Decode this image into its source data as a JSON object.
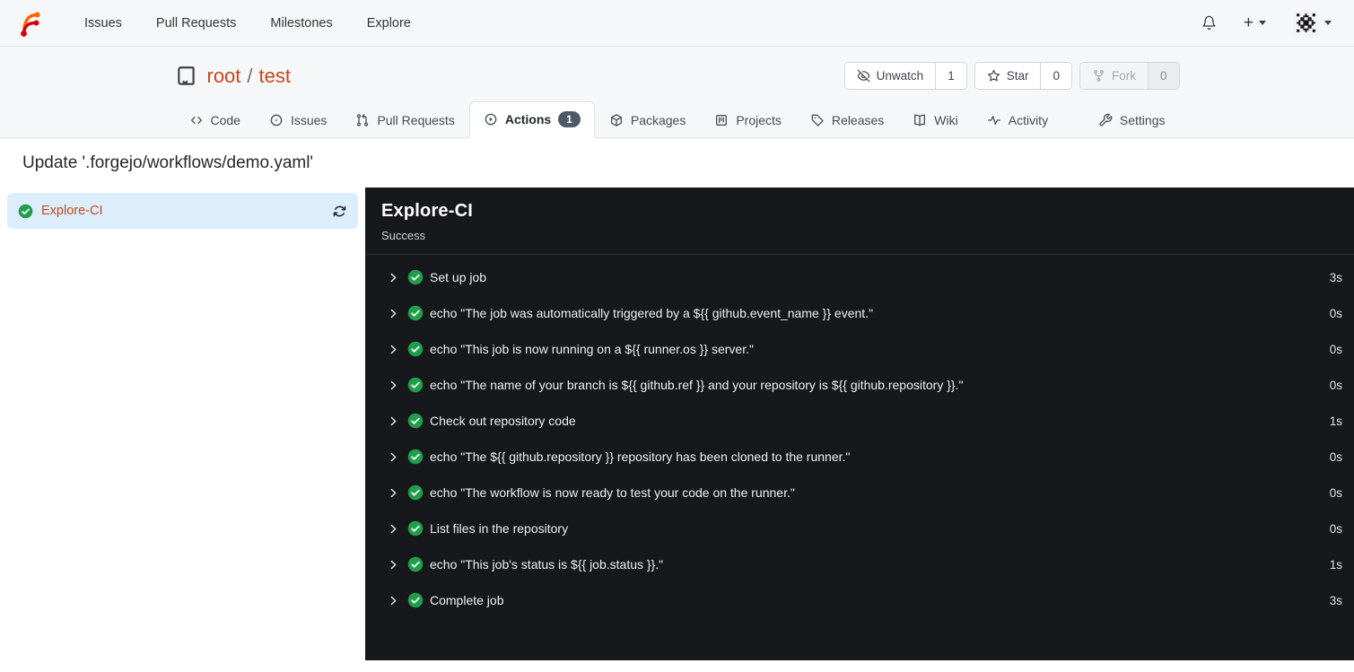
{
  "navbar": {
    "items": [
      {
        "label": "Issues"
      },
      {
        "label": "Pull Requests"
      },
      {
        "label": "Milestones"
      },
      {
        "label": "Explore"
      }
    ]
  },
  "repo_header": {
    "owner": "root",
    "separator": "/",
    "name": "test",
    "actions": {
      "unwatch": {
        "label": "Unwatch",
        "count": "1"
      },
      "star": {
        "label": "Star",
        "count": "0"
      },
      "fork": {
        "label": "Fork",
        "count": "0"
      }
    },
    "tabs": [
      {
        "label": "Code"
      },
      {
        "label": "Issues"
      },
      {
        "label": "Pull Requests"
      },
      {
        "label": "Actions",
        "badge": "1"
      },
      {
        "label": "Packages"
      },
      {
        "label": "Projects"
      },
      {
        "label": "Releases"
      },
      {
        "label": "Wiki"
      },
      {
        "label": "Activity"
      }
    ],
    "settings_tab": {
      "label": "Settings"
    }
  },
  "page": {
    "title": "Update '.forgejo/workflows/demo.yaml'"
  },
  "sidebar": {
    "job": {
      "name": "Explore-CI",
      "status": "success"
    }
  },
  "run_panel": {
    "title": "Explore-CI",
    "status": "Success",
    "steps": [
      {
        "name": "Set up job",
        "duration": "3s"
      },
      {
        "name": "echo \"The job was automatically triggered by a ${{ github.event_name }} event.\"",
        "duration": "0s"
      },
      {
        "name": "echo \"This job is now running on a ${{ runner.os }} server.\"",
        "duration": "0s"
      },
      {
        "name": "echo \"The name of your branch is ${{ github.ref }} and your repository is ${{ github.repository }}.\"",
        "duration": "0s"
      },
      {
        "name": "Check out repository code",
        "duration": "1s"
      },
      {
        "name": "echo \"The ${{ github.repository }} repository has been cloned to the runner.\"",
        "duration": "0s"
      },
      {
        "name": "echo \"The workflow is now ready to test your code on the runner.\"",
        "duration": "0s"
      },
      {
        "name": "List files in the repository",
        "duration": "0s"
      },
      {
        "name": "echo \"This job's status is ${{ job.status }}.\"",
        "duration": "1s"
      },
      {
        "name": "Complete job",
        "duration": "3s"
      }
    ]
  },
  "colors": {
    "accent": "#c7481d",
    "success": "#1f9e4b",
    "selected_bg": "#dceefb",
    "panel_bg": "#17181c",
    "badge_bg": "#4e5866",
    "header_bg": "#f6f7f8"
  }
}
